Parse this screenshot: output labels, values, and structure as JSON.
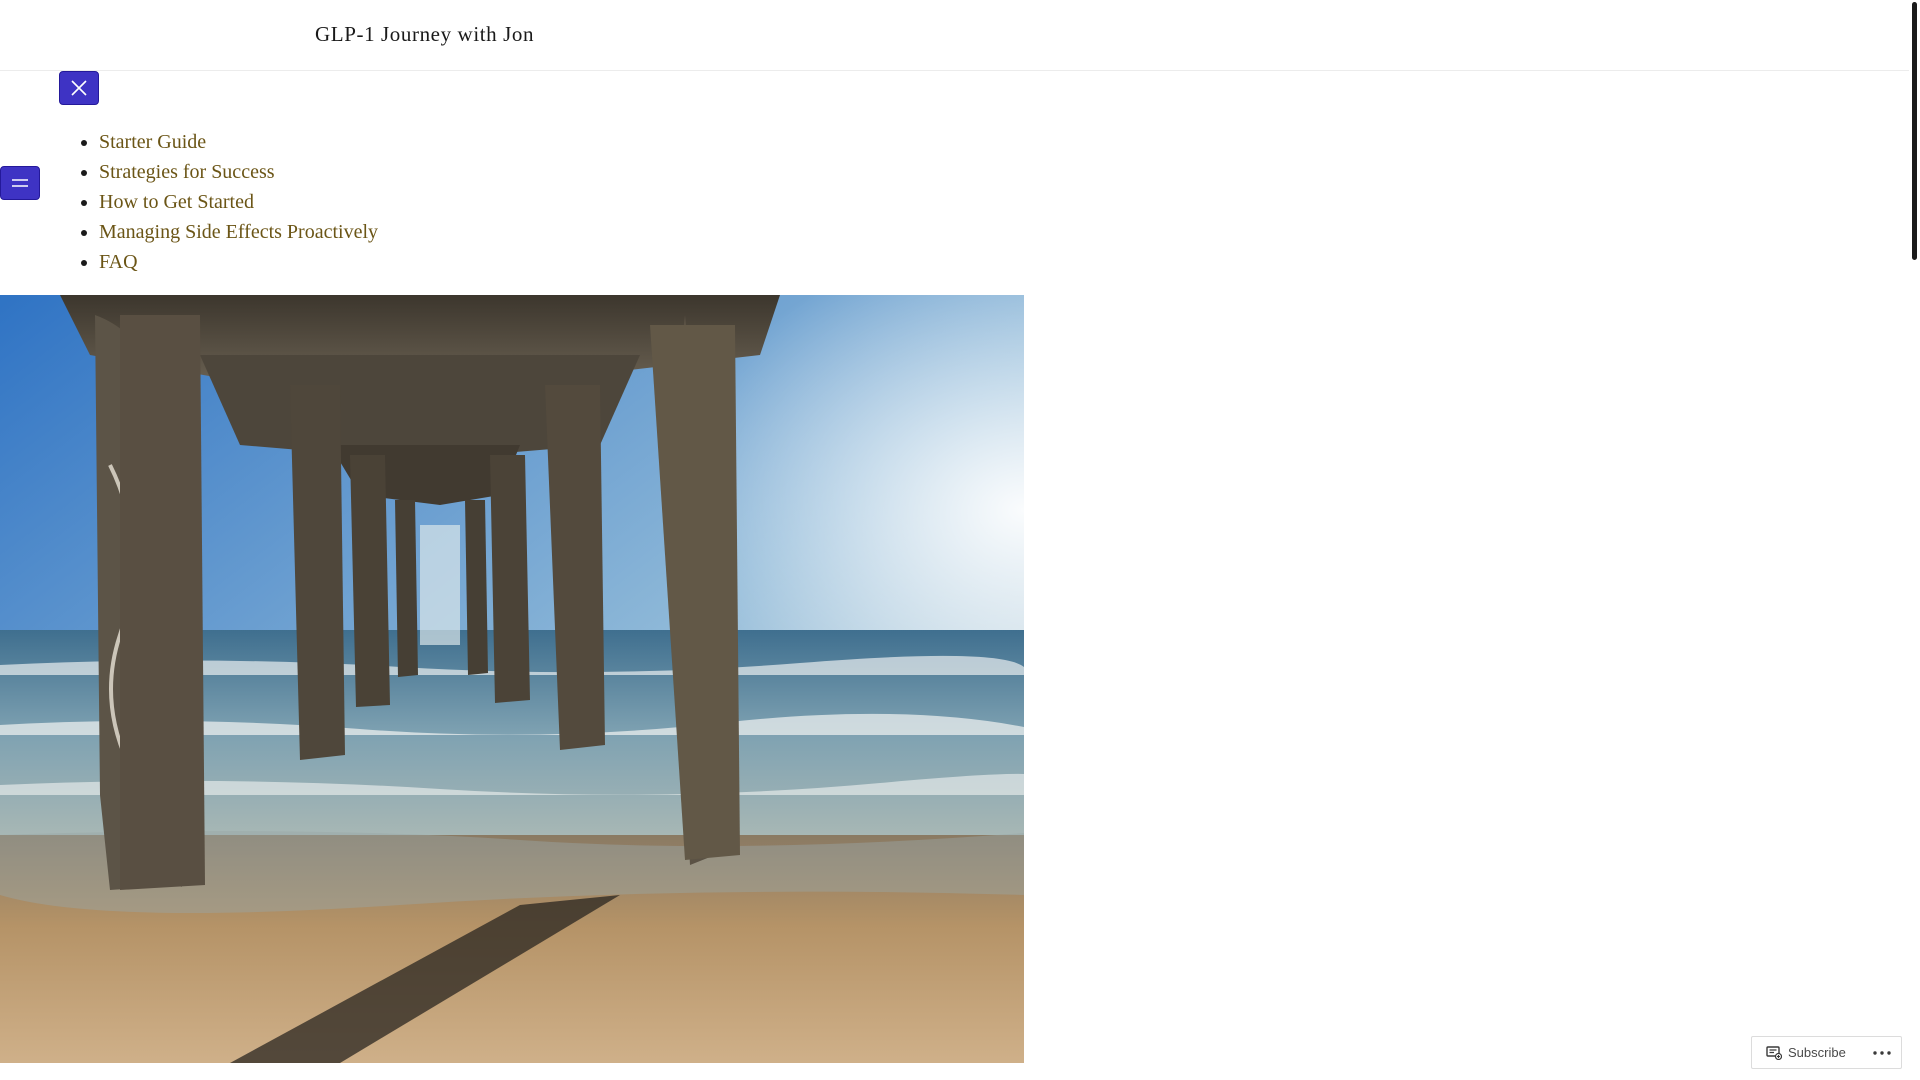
{
  "header": {
    "site_title": "GLP-1 Journey with Jon"
  },
  "nav": {
    "close_icon": "close-icon",
    "menu_icon": "hamburger-icon",
    "items": [
      {
        "label": "Starter Guide"
      },
      {
        "label": "Strategies for Success"
      },
      {
        "label": "How to Get Started"
      },
      {
        "label": "Managing Side Effects Proactively"
      },
      {
        "label": "FAQ"
      }
    ]
  },
  "colors": {
    "accent": "#3e33c4",
    "link": "#6b5516",
    "sky_top": "#3b7fc9",
    "sky_bottom": "#e8f0ee",
    "sand": "#b59367",
    "pillar": "#5c5447"
  },
  "subscribe": {
    "label": "Subscribe",
    "icon": "subscribe-icon",
    "more_icon": "ellipsis-icon"
  }
}
